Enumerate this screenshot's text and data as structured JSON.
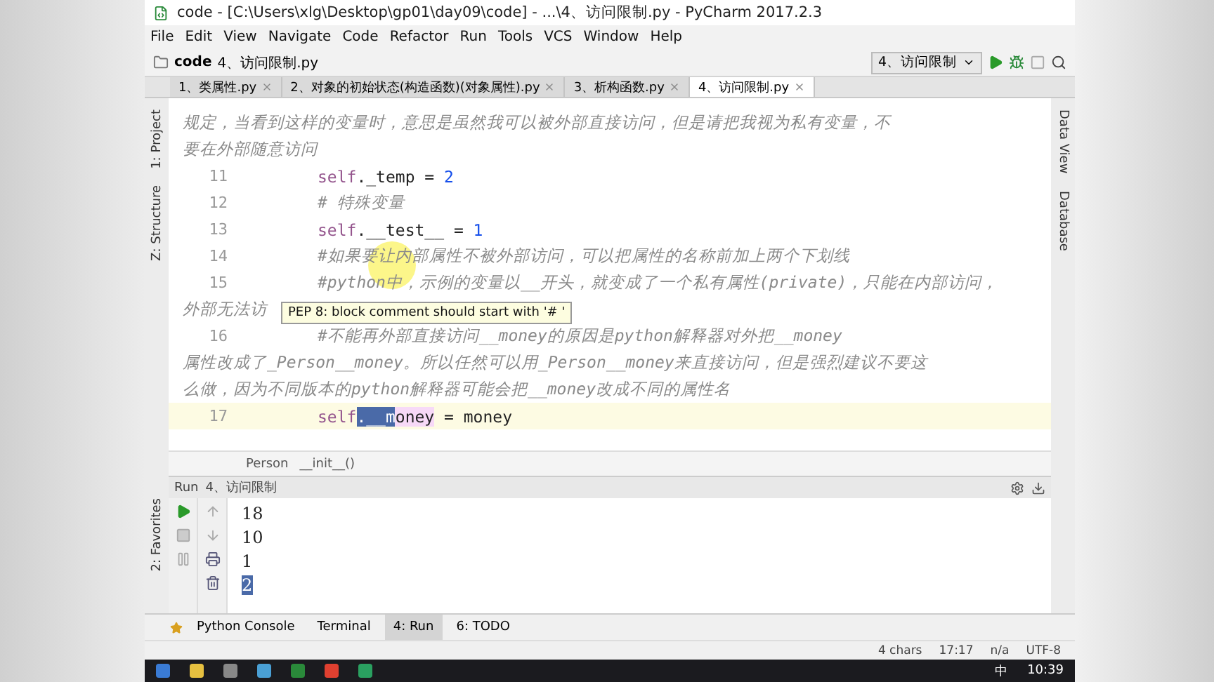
{
  "window": {
    "title": "code - [C:\\Users\\xlg\\Desktop\\gp01\\day09\\code] - ...\\4、访问限制.py - PyCharm 2017.2.3"
  },
  "menu": [
    "File",
    "Edit",
    "View",
    "Navigate",
    "Code",
    "Refactor",
    "Run",
    "Tools",
    "VCS",
    "Window",
    "Help"
  ],
  "nav": {
    "project": "code",
    "file": "4、访问限制.py",
    "run_config": "4、访问限制"
  },
  "tabs": [
    {
      "label": "1、类属性.py",
      "selected": false
    },
    {
      "label": "2、对象的初始状态(构造函数)(对象属性).py",
      "selected": false
    },
    {
      "label": "3、析构函数.py",
      "selected": false
    },
    {
      "label": "4、访问限制.py",
      "selected": true
    }
  ],
  "left_strip": [
    "1: Project",
    "Z: Structure"
  ],
  "right_strip": [
    "Data View",
    "Database"
  ],
  "editor": {
    "lines": [
      {
        "kind": "wrap",
        "segments": [
          {
            "kind": "comment",
            "text": "规定，当看到这样的变量时，意思是虽然我可以被外部直接访问，但是请把我视为私有变量，不"
          }
        ]
      },
      {
        "kind": "wrap",
        "segments": [
          {
            "kind": "comment",
            "text": "要在外部随意访问"
          }
        ]
      },
      {
        "kind": "code",
        "number": "11",
        "current": false,
        "segments": [
          {
            "kind": "self",
            "text": "self"
          },
          {
            "kind": "plain",
            "text": "._temp = "
          },
          {
            "kind": "number",
            "text": "2"
          }
        ]
      },
      {
        "kind": "code",
        "number": "12",
        "current": false,
        "segments": [
          {
            "kind": "comment",
            "text": "# 特殊变量"
          }
        ]
      },
      {
        "kind": "code",
        "number": "13",
        "current": false,
        "segments": [
          {
            "kind": "self",
            "text": "self"
          },
          {
            "kind": "plain",
            "text": ".__test__ = "
          },
          {
            "kind": "number",
            "text": "1"
          }
        ]
      },
      {
        "kind": "code",
        "number": "14",
        "current": false,
        "segments": [
          {
            "kind": "comment",
            "text": "#如果要让内部属性不被外部访问，可以把属性的名称前加上两个下划线"
          }
        ]
      },
      {
        "kind": "code",
        "number": "15",
        "current": false,
        "segments": [
          {
            "kind": "comment",
            "text": "#python中，示例的变量以__开头，就变成了一个私有属性(private)，只能在内部访问，"
          }
        ]
      },
      {
        "kind": "wrap",
        "segments": [
          {
            "kind": "comment",
            "text": "外部无法访"
          }
        ]
      },
      {
        "kind": "code",
        "number": "16",
        "current": false,
        "segments": [
          {
            "kind": "comment",
            "text": "#不能再外部直接访问__money的原因是python解释器对外把__money"
          }
        ]
      },
      {
        "kind": "wrap",
        "segments": [
          {
            "kind": "comment",
            "text": "属性改成了_Person__money。所以任然可以用_Person__money来直接访问，但是强烈建议不要这"
          }
        ]
      },
      {
        "kind": "wrap",
        "segments": [
          {
            "kind": "comment",
            "text": "么做，因为不同版本的python解释器可能会把__money改成不同的属性名"
          }
        ]
      },
      {
        "kind": "code",
        "number": "17",
        "current": true,
        "segments": [
          {
            "kind": "self",
            "text": "self"
          },
          {
            "kind": "selection",
            "text": ".__m"
          },
          {
            "kind": "match",
            "text": "oney"
          },
          {
            "kind": "plain",
            "text": " = money"
          }
        ]
      }
    ],
    "tooltip": "PEP 8: block comment should start with '# '"
  },
  "breadcrumb": [
    "Person",
    "__init__()"
  ],
  "run": {
    "label": "Run",
    "config": "4、访问限制",
    "output": [
      {
        "text": "18",
        "selected": false
      },
      {
        "text": "10",
        "selected": false
      },
      {
        "text": "1",
        "selected": false
      },
      {
        "text": "2",
        "selected": true
      }
    ],
    "favorites": "2: Favorites"
  },
  "tool_tabs": [
    {
      "label": "Python Console",
      "selected": false
    },
    {
      "label": "Terminal",
      "selected": false
    },
    {
      "label": "4: Run",
      "selected": true
    },
    {
      "label": "6: TODO",
      "selected": false
    }
  ],
  "status_bar": [
    "4 chars",
    "17:17",
    "n/a",
    "UTF-8"
  ],
  "taskbar": {
    "ime": "中",
    "time": "10:39"
  }
}
